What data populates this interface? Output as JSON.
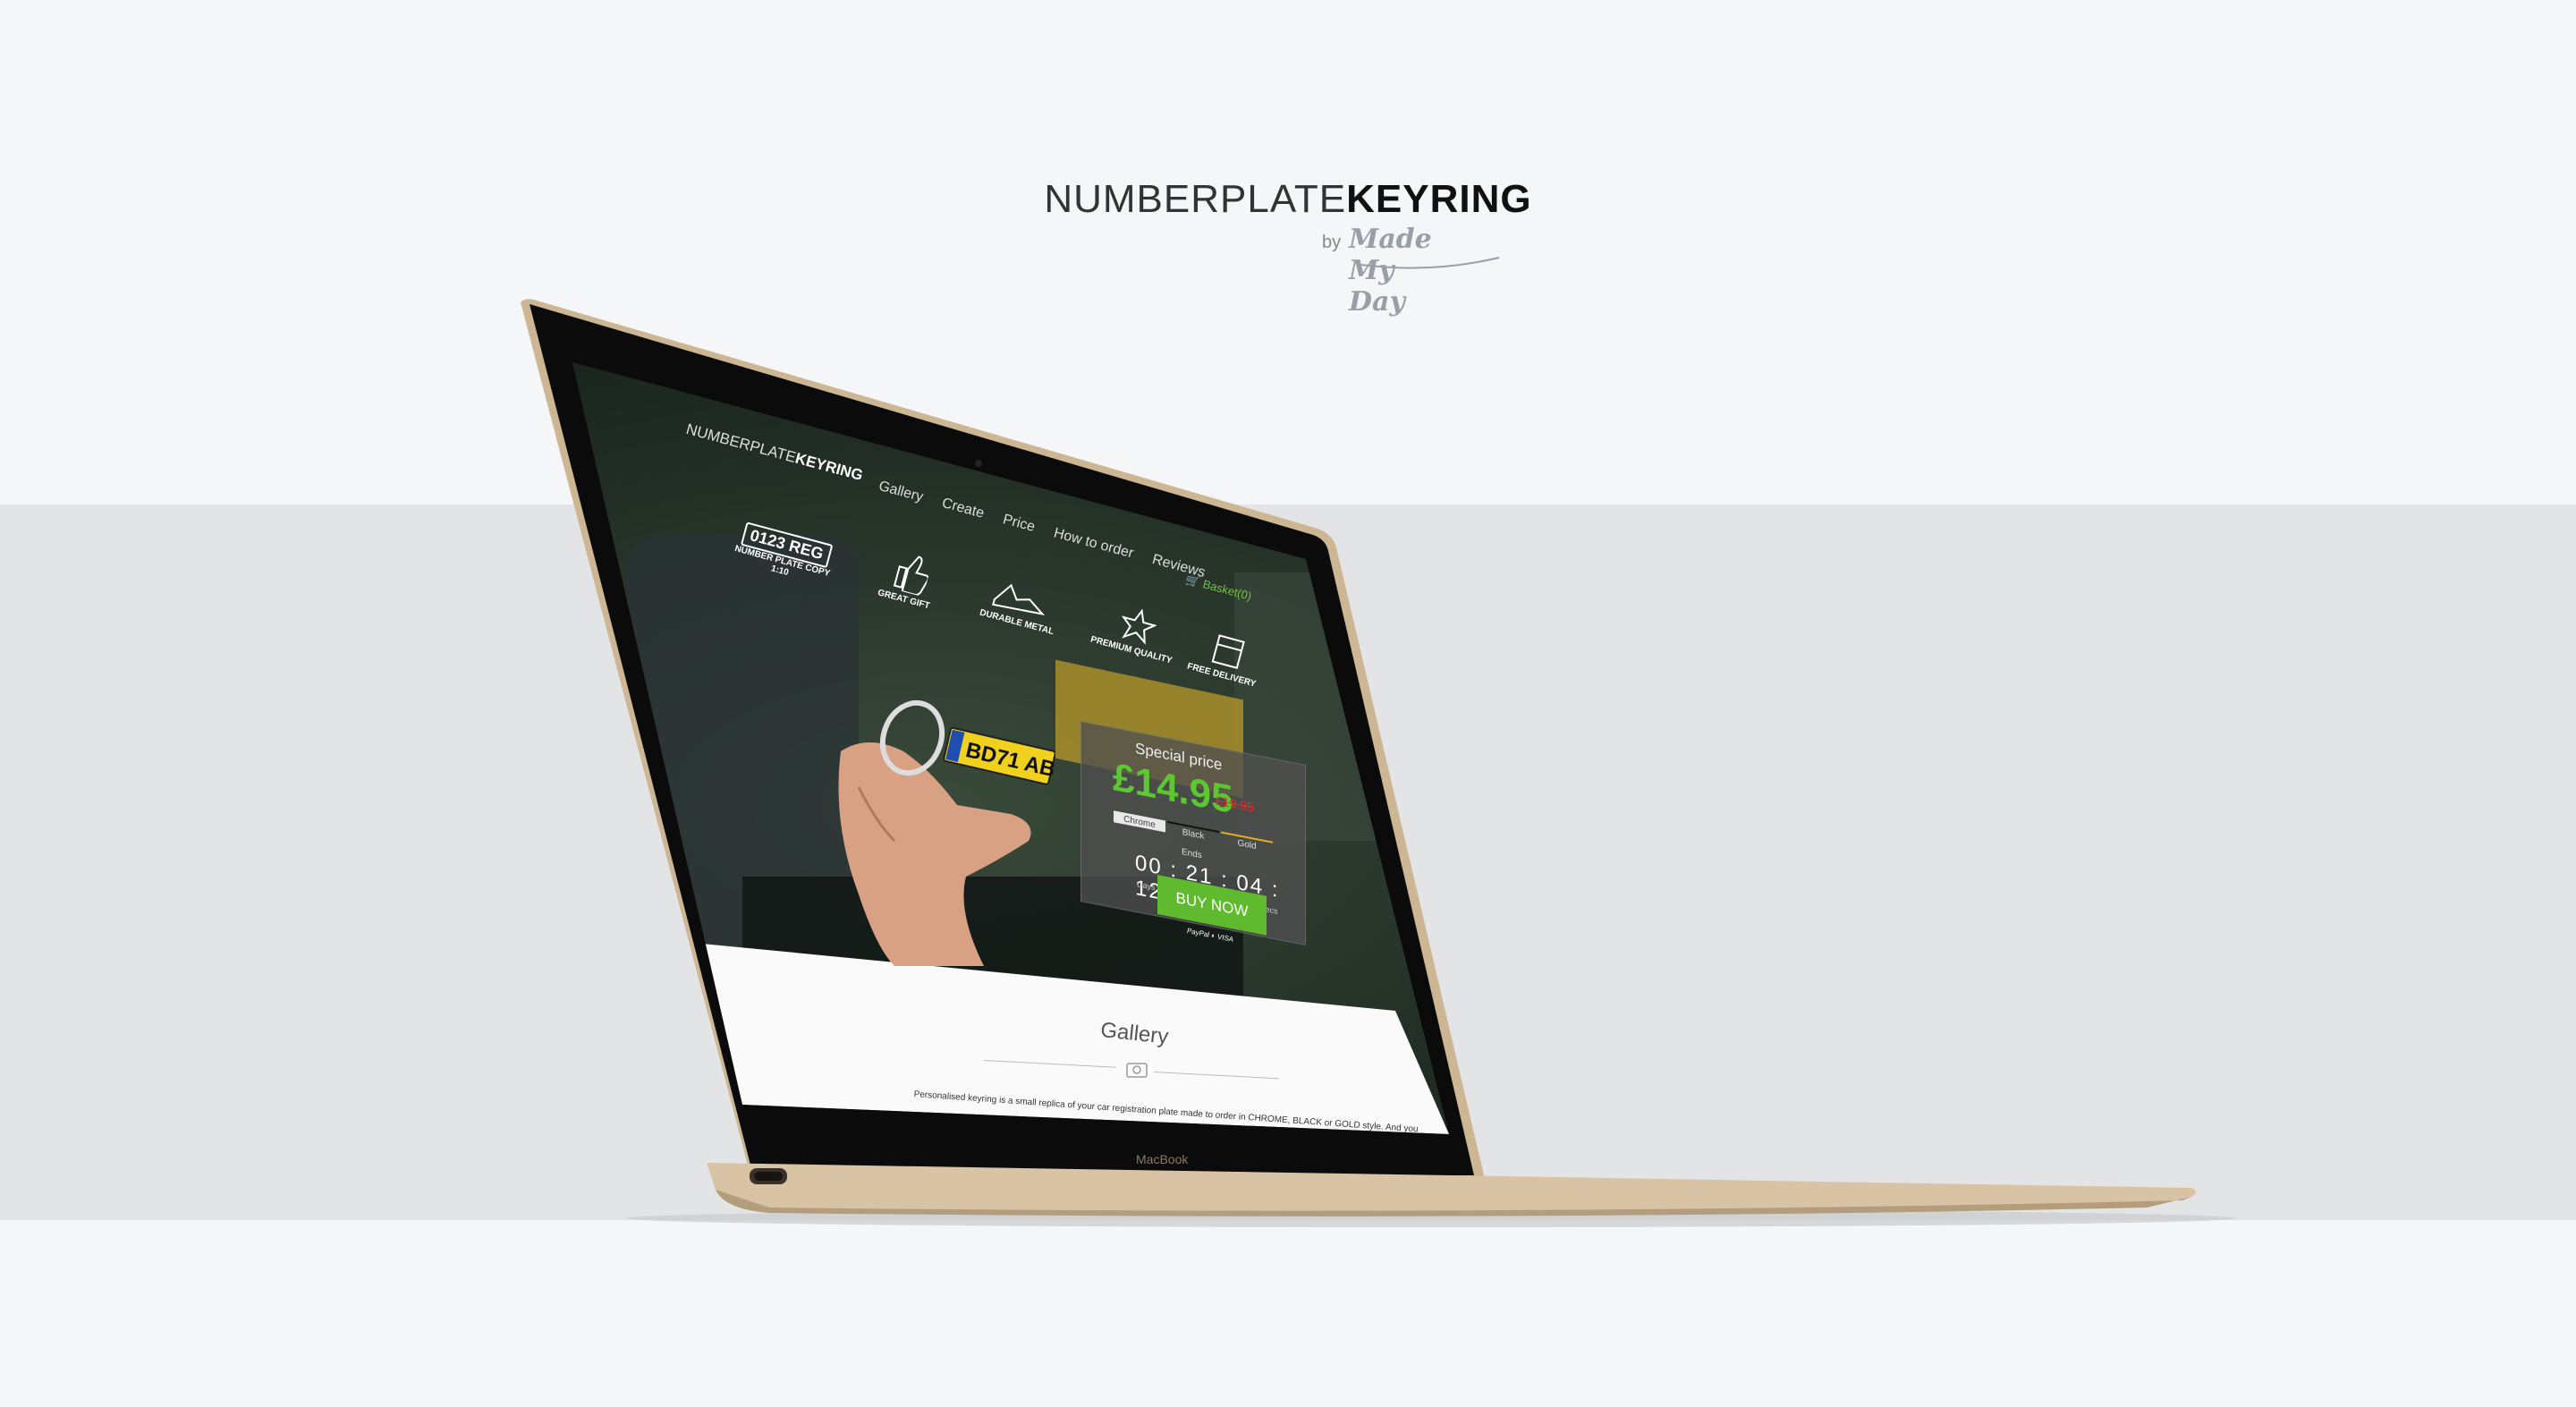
{
  "brand": {
    "title_light": "NUMBERPLATE",
    "title_bold": "KEYRING",
    "by": "by",
    "maker": "Made My Day"
  },
  "site": {
    "logo_light": "NUMBERPLATE",
    "logo_bold": "KEYRING",
    "nav": [
      "Gallery",
      "Create",
      "Price",
      "How to order",
      "Reviews"
    ],
    "basket": "Basket(0)",
    "features": {
      "plate": "0123 REG",
      "plate_caption_1": "NUMBER PLATE COPY",
      "plate_caption_2": "1:10",
      "great_gift": "GREAT GIFT",
      "durable_metal": "DURABLE METAL",
      "premium_quality": "PREMIUM QUALITY",
      "free_delivery": "FREE DELIVERY"
    },
    "keyring_plate": "BD71 ABC",
    "price_panel": {
      "title": "Special price",
      "price": "£14.95",
      "old_price": "£19.95",
      "tabs": [
        "Chrome",
        "Black",
        "Gold"
      ],
      "ends": "Ends",
      "countdown": "00 : 21 : 04 : 12",
      "units": "Days Hours Minutes Secs"
    },
    "buy_now": "BUY NOW",
    "payments": "PayPal ◐ VISA",
    "gallery_title": "Gallery",
    "gallery_text": "Personalised keyring is a small replica of your car registration plate made to order in CHROME, BLACK or GOLD style. And you"
  },
  "device_label": "MacBook",
  "colors": {
    "accent_green": "#5fba2d",
    "price_green": "#5cc733",
    "old_price_red": "#e32b2b",
    "laptop_gold": "#d9c3a5"
  }
}
